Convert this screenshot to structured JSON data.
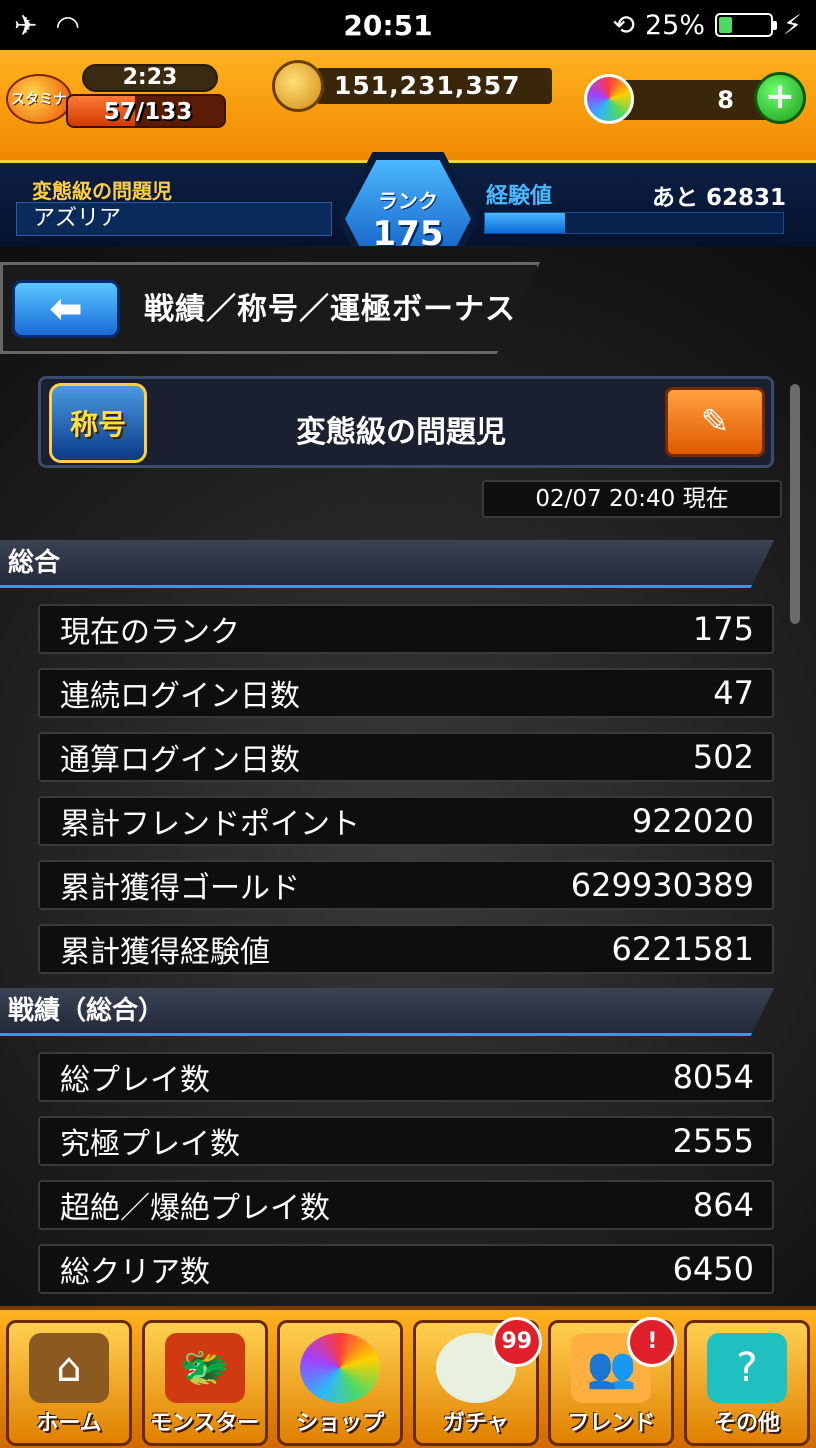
{
  "status_bar": {
    "time": "20:51",
    "battery": "25%",
    "battery_level": 0.25
  },
  "header": {
    "stamina_icon_label": "スタミナ",
    "stamina_timer": "2:23",
    "stamina": "57/133",
    "stamina_fraction": 0.43,
    "gold": "151,231,357",
    "orbs": "8",
    "rank_label": "ランク",
    "rank": "175",
    "player_title": "変態級の問題児",
    "player_name": "アズリア",
    "exp_label": "経験値",
    "exp_remaining": "あと 62831",
    "exp_fraction": 0.27
  },
  "page": {
    "title": "戦績／称号／運極ボーナス",
    "title_badge": "称号",
    "current_title": "変態級の問題児",
    "timestamp": "02/07 20:40 現在"
  },
  "sections": [
    {
      "name": "総合",
      "rows": [
        {
          "label": "現在のランク",
          "value": "175"
        },
        {
          "label": "連続ログイン日数",
          "value": "47"
        },
        {
          "label": "通算ログイン日数",
          "value": "502"
        },
        {
          "label": "累計フレンドポイント",
          "value": "922020"
        },
        {
          "label": "累計獲得ゴールド",
          "value": "629930389"
        },
        {
          "label": "累計獲得経験値",
          "value": "6221581"
        }
      ]
    },
    {
      "name": "戦績（総合）",
      "rows": [
        {
          "label": "総プレイ数",
          "value": "8054"
        },
        {
          "label": "究極プレイ数",
          "value": "2555"
        },
        {
          "label": "超絶／爆絶プレイ数",
          "value": "864"
        },
        {
          "label": "総クリア数",
          "value": "6450"
        }
      ]
    }
  ],
  "bottom_nav": [
    {
      "label": "ホーム",
      "icon": "home-icon"
    },
    {
      "label": "モンスター",
      "icon": "monster-icon"
    },
    {
      "label": "ショップ",
      "icon": "shop-orb-icon"
    },
    {
      "label": "ガチャ",
      "icon": "gacha-egg-icon",
      "badge": "99"
    },
    {
      "label": "フレンド",
      "icon": "friend-icon",
      "badge": "!"
    },
    {
      "label": "その他",
      "icon": "other-icon"
    }
  ]
}
